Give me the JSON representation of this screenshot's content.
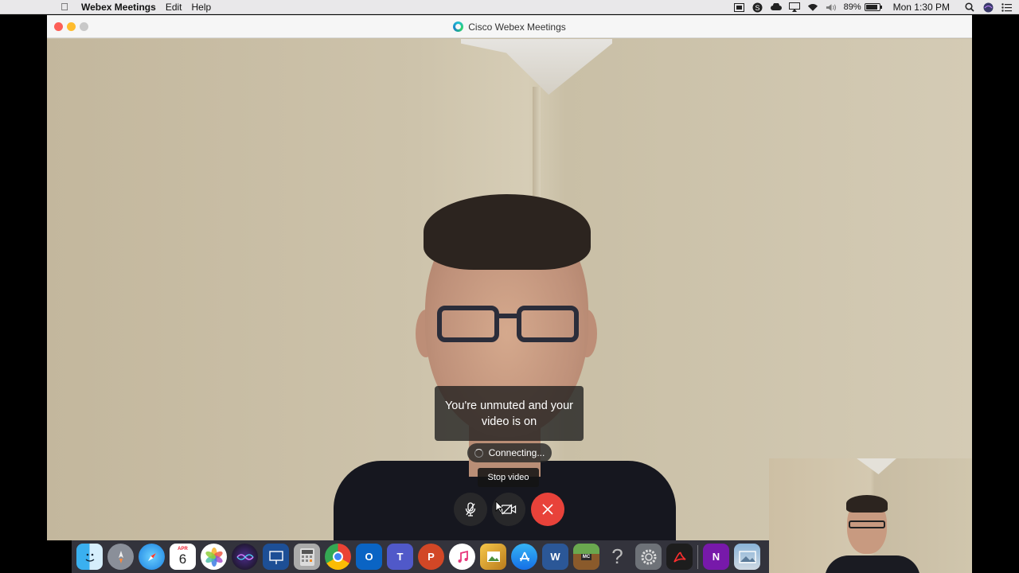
{
  "menubar": {
    "app_name": "Webex Meetings",
    "menus": [
      "Edit",
      "Help"
    ],
    "battery_percent": "89%",
    "battery_level": 0.89,
    "clock": "Mon 1:30 PM",
    "status_icons": [
      "screen-mirror-icon",
      "skype-icon",
      "creative-cloud-icon",
      "airplay-icon",
      "wifi-icon",
      "volume-icon",
      "battery-icon",
      "spotlight-icon",
      "siri-icon",
      "notification-center-icon"
    ]
  },
  "window": {
    "title": "Cisco Webex Meetings"
  },
  "meeting": {
    "notice": "You're unmuted and your video is on",
    "connecting": "Connecting...",
    "tooltip": "Stop video",
    "controls": [
      "mute-icon",
      "video-icon",
      "end-call-icon"
    ],
    "end_color": "#e8423a"
  },
  "dock": {
    "calendar_month": "APR",
    "calendar_day": "6",
    "apps": [
      "finder",
      "launchpad",
      "safari",
      "calendar",
      "photos",
      "siri",
      "keynote",
      "calculator",
      "chrome",
      "outlook",
      "teams",
      "powerpoint",
      "itunes",
      "preview",
      "app-store",
      "word",
      "minecraft",
      "help",
      "system-preferences",
      "acrobat",
      "onenote",
      "photo-browser"
    ]
  }
}
